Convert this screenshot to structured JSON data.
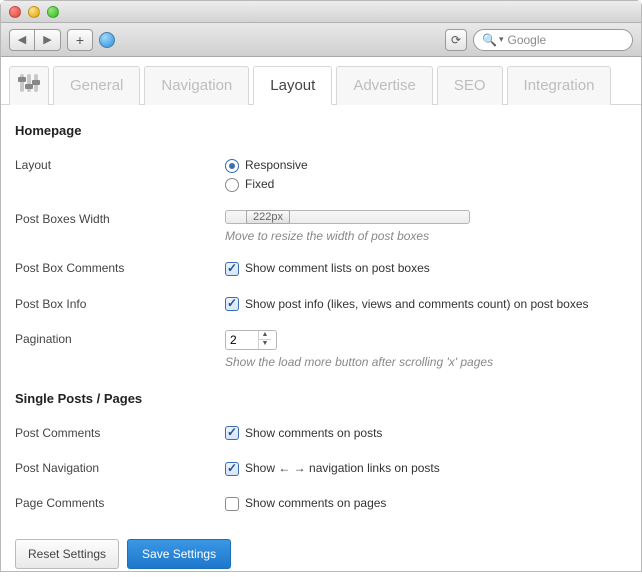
{
  "browser": {
    "search_placeholder": "Google"
  },
  "tabs": {
    "general": "General",
    "navigation": "Navigation",
    "layout": "Layout",
    "advertise": "Advertise",
    "seo": "SEO",
    "integration": "Integration"
  },
  "sections": {
    "homepage": "Homepage",
    "single": "Single Posts / Pages"
  },
  "labels": {
    "layout": "Layout",
    "post_boxes_width": "Post Boxes Width",
    "post_box_comments": "Post Box Comments",
    "post_box_info": "Post Box Info",
    "pagination": "Pagination",
    "post_comments": "Post Comments",
    "post_navigation": "Post Navigation",
    "page_comments": "Page Comments"
  },
  "options": {
    "layout_responsive": "Responsive",
    "layout_fixed": "Fixed",
    "pbw_value": "222px",
    "pbw_hint": "Move to resize the width of post boxes",
    "pbc_label": "Show comment lists on post boxes",
    "pbi_label": "Show post info (likes, views and comments count) on post boxes",
    "pagination_value": "2",
    "pagination_hint": "Show the load more button after scrolling 'x' pages",
    "pc_label": "Show comments on posts",
    "pn_label": "Show ← → navigation links on posts",
    "pgc_label": "Show comments on pages"
  },
  "state": {
    "layout_selected": "responsive",
    "pbc_checked": true,
    "pbi_checked": true,
    "pc_checked": true,
    "pn_checked": true,
    "pgc_checked": false
  },
  "buttons": {
    "reset": "Reset Settings",
    "save": "Save Settings"
  }
}
